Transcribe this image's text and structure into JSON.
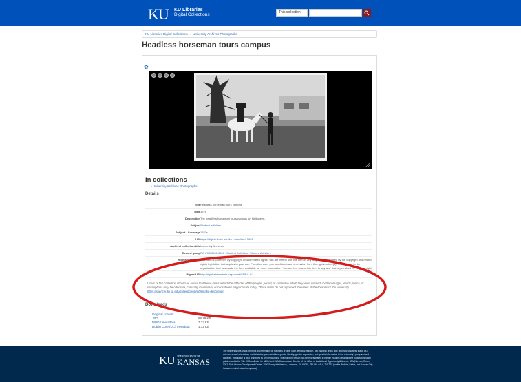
{
  "header": {
    "logo_ku": "KU",
    "logo_line1": "KU Libraries",
    "logo_line2": "Digital Collections",
    "scope_select": "This collection",
    "search_placeholder": ""
  },
  "breadcrumb": {
    "items": [
      "KU Libraries Digital Collections",
      "University Archives Photographs"
    ]
  },
  "page_title": "Headless horseman tours campus",
  "in_collections": {
    "heading": "In collections",
    "items": [
      "University Archives Photographs"
    ]
  },
  "details": {
    "heading": "Details",
    "rows": [
      {
        "label": "Title",
        "value": "Headless horseman tours campus"
      },
      {
        "label": "Date",
        "value": "1978"
      },
      {
        "label": "Description",
        "value": "The headless horseman tours campus on Halloween."
      },
      {
        "label": "Subject",
        "value": "Student activities"
      },
      {
        "label": "Subject - Coverage",
        "value": "1970s"
      },
      {
        "label": "URI",
        "value": "https://digital.lib.ku.edu/ku-uaimalien/15988"
      },
      {
        "label": "Archival collection title",
        "value": "University Archives"
      },
      {
        "label": "Record group",
        "value": "RG 67/0 0000.0000 : Student Activities : Student Activities"
      },
      {
        "label": "Rights statement",
        "value": "This Item is protected by copyright and/or related rights. You are free to use this Item in any way that is permitted by the copyright and related rights legislation that applies to your use. For other uses you need to obtain permission from the rights-holder(s). Please refer to the organization that has made the Item available for more information. You are free to use this Item in any way that is permitted by the copyright and related rights legislation that applies to your use."
      },
      {
        "label": "Rights URI",
        "value": "http://rightsstatements.org/vocab/CNE/1.0/"
      }
    ]
  },
  "notice": {
    "text": "Users of this collection should be aware that these items reflect the attitudes of the people, period, or context in which they were created. Certain images, words, terms, or descriptions may be offensive, culturally insensitive, or considered inappropriate today. These items do not represent the views of the libraries or the university.",
    "link": "https://spencer.lib.ku.edu/collections/problematic-description"
  },
  "downloads": {
    "heading": "Downloads",
    "items": [
      {
        "label": "Original content",
        "size": ""
      },
      {
        "label": "JPG",
        "size": "88.19 KB"
      },
      {
        "label": "MODS metadata",
        "size": "7.73 KB"
      },
      {
        "label": "Dublin Core (DC) metadata",
        "size": "1.12 KB"
      }
    ]
  },
  "footer": {
    "univ": "THE UNIVERSITY OF",
    "kansas": "KANSAS",
    "ku": "KU",
    "text": "The University of Kansas prohibits discrimination on the basis of race, color, ethnicity, religion, sex, national origin, age, ancestry, disability, status as a veteran, sexual orientation, marital status, parental status, gender identity, gender expression, and genetic information in the university's programs and activities. Retaliation is also prohibited by university policy. The following person has been designated to handle inquiries regarding the nondiscrimination policies and is the Title IX Coordinator for all KU and KUMC campuses: Director of the Office of Institutional Opportunity & Access, IOA@ku.edu, Room 1082, Dole Human Development Center, 1000 Sunnyside Avenue, Lawrence, KS 66045, 785-864-6414, 711 TTY (for the Wichita, Salina, and Kansas City, Kansas medical school campuses)."
  },
  "colors": {
    "header_bg": "#0051ba",
    "footer_bg": "#00294d",
    "link": "#2a6ab4",
    "search_button": "#8b1a1a",
    "annotation": "#d41c1c"
  }
}
